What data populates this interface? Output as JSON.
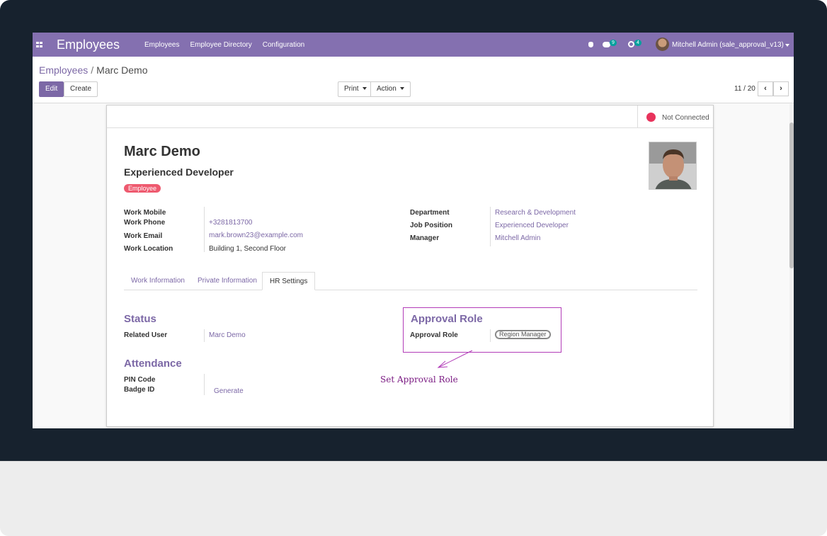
{
  "navbar": {
    "brand": "Employees",
    "menu": [
      "Employees",
      "Employee Directory",
      "Configuration"
    ],
    "messages_count": "9",
    "activities_count": "4",
    "user": "Mitchell Admin (sale_approval_v13)",
    "color": "#8470b0"
  },
  "breadcrumb": {
    "parent": "Employees",
    "current": "Marc Demo"
  },
  "buttons": {
    "edit": "Edit",
    "create": "Create",
    "print": "Print",
    "action": "Action"
  },
  "pager": {
    "text": "11 / 20",
    "prev_icon": "chevron-left-icon",
    "next_icon": "chevron-right-icon"
  },
  "status": {
    "label": "Not Connected",
    "color": "#e8335c"
  },
  "employee": {
    "name": "Marc Demo",
    "job_title": "Experienced Developer",
    "tag": "Employee"
  },
  "fields_left": [
    {
      "label": "Work Mobile",
      "value": ""
    },
    {
      "label": "Work Phone",
      "value": "+3281813700"
    },
    {
      "label": "Work Email",
      "value": "mark.brown23@example.com"
    },
    {
      "label": "Work Location",
      "value": "Building 1, Second Floor"
    }
  ],
  "fields_right": [
    {
      "label": "Department",
      "value": "Research & Development"
    },
    {
      "label": "Job Position",
      "value": "Experienced Developer"
    },
    {
      "label": "Manager",
      "value": "Mitchell Admin"
    }
  ],
  "tabs": [
    "Work Information",
    "Private Information",
    "HR Settings"
  ],
  "hr_settings": {
    "status_title": "Status",
    "related_user_label": "Related User",
    "related_user_value": "Marc Demo",
    "attendance_title": "Attendance",
    "pin_label": "PIN Code",
    "badge_label": "Badge ID",
    "generate_label": "Generate",
    "approval_title": "Approval Role",
    "approval_label": "Approval Role",
    "approval_value": "Region Manager"
  },
  "annotation": {
    "text": "Set  Approval  Role",
    "color": "#7a1a82"
  }
}
